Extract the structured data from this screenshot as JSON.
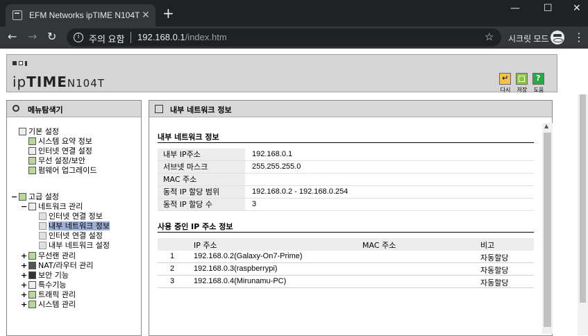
{
  "browser": {
    "tab_title": "EFM Networks ipTIME N104T",
    "new_tab": "+",
    "warning": "주의 요함",
    "url_host": "192.168.0.1",
    "url_path": "/index.htm",
    "incognito_label": "시크릿 모드"
  },
  "header": {
    "logo_prefix": "ip",
    "logo_brand": "TIME",
    "logo_model": "N104T",
    "buttons": [
      {
        "label": "다시",
        "icon": "refresh-icon",
        "color": "#e8c23a"
      },
      {
        "label": "저장",
        "icon": "save-icon",
        "color": "#8cc63f"
      },
      {
        "label": "도움",
        "icon": "help-icon",
        "color": "#2aa845"
      }
    ]
  },
  "sidebar": {
    "title": "메뉴탐색기",
    "basic": {
      "label": "기본 설정",
      "items": [
        "시스템 요약 정보",
        "인터넷 연결 설정",
        "무선 설정/보안",
        "펌웨어 업그레이드"
      ]
    },
    "advanced": {
      "label": "고급 설정",
      "network": {
        "label": "네트워크 관리",
        "items": [
          "인터넷 연결 정보",
          "내부 네트워크 정보",
          "인터넷 연결 설정",
          "내부 네트워크 설정"
        ]
      },
      "others": [
        "무선랜 관리",
        "NAT/라우터 관리",
        "보안 기능",
        "특수기능",
        "트래픽 관리",
        "시스템 관리"
      ]
    }
  },
  "main": {
    "title": "내부 네트워크 정보",
    "section1_title": "내부 네트워크 정보",
    "info": [
      {
        "key": "내부 IP주소",
        "value": "192.168.0.1"
      },
      {
        "key": "서브넷 마스크",
        "value": "255.255.255.0"
      },
      {
        "key": "MAC 주소",
        "value": ""
      },
      {
        "key": "동적 IP 할당 범위",
        "value": "192.168.0.2 - 192.168.0.254"
      },
      {
        "key": "동적 IP 할당 수",
        "value": "3"
      }
    ],
    "section2_title": "사용 중인 IP 주소 정보",
    "table_headers": [
      "IP 주소",
      "MAC 주소",
      "비고"
    ],
    "rows": [
      {
        "num": "1",
        "ip": "192.168.0.2(Galaxy-On7-Prime)",
        "mac": "",
        "note": "자동할당"
      },
      {
        "num": "2",
        "ip": "192.168.0.3(raspberrypi)",
        "mac": "",
        "note": "자동할당"
      },
      {
        "num": "3",
        "ip": "192.168.0.4(Mirunamu-PC)",
        "mac": "",
        "note": "자동할당"
      }
    ]
  }
}
